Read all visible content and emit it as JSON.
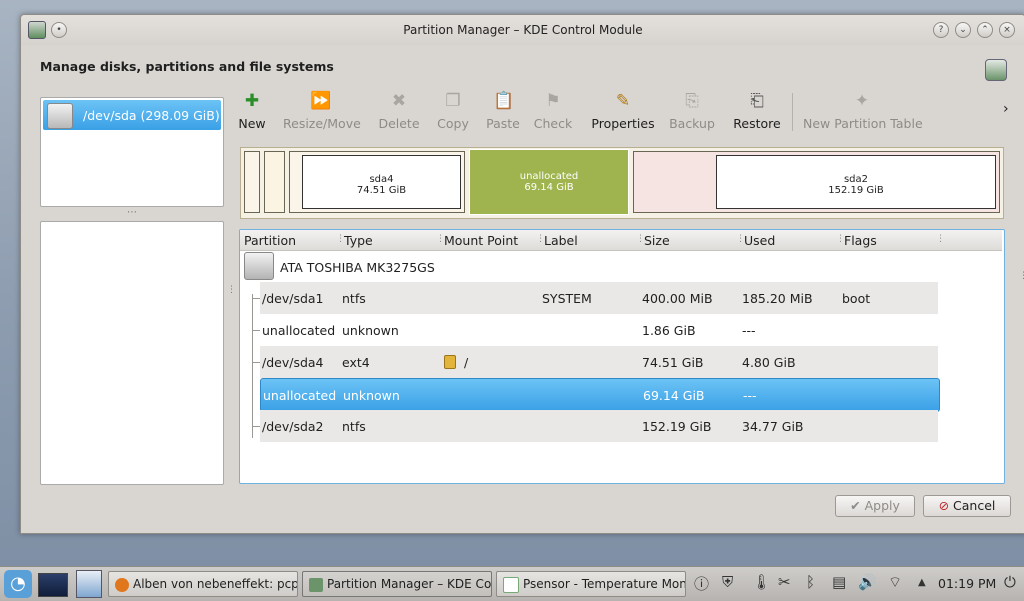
{
  "window": {
    "title": "Partition Manager – KDE Control Module"
  },
  "heading": "Manage disks, partitions and file systems",
  "devices": [
    {
      "label": "/dev/sda (298.09 GiB)"
    }
  ],
  "toolbar": {
    "items": [
      {
        "label": "New",
        "icon": "new-partition-icon",
        "enabled": true
      },
      {
        "label": "Resize/Move",
        "icon": "resize-icon",
        "enabled": false
      },
      {
        "label": "Delete",
        "icon": "delete-icon",
        "enabled": false
      },
      {
        "label": "Copy",
        "icon": "copy-icon",
        "enabled": false
      },
      {
        "label": "Paste",
        "icon": "paste-icon",
        "enabled": false
      },
      {
        "label": "Check",
        "icon": "check-icon",
        "enabled": false
      },
      {
        "label": "Properties",
        "icon": "properties-icon",
        "enabled": true
      },
      {
        "label": "Backup",
        "icon": "backup-icon",
        "enabled": false
      },
      {
        "label": "Restore",
        "icon": "restore-icon",
        "enabled": true
      },
      {
        "label": "New Partition Table",
        "icon": "partition-table-icon",
        "enabled": false
      }
    ],
    "more": "›"
  },
  "graph": {
    "sda4": {
      "name": "sda4",
      "size": "74.51 GiB"
    },
    "unalloc": {
      "name": "unallocated",
      "size": "69.14 GiB"
    },
    "sda2": {
      "name": "sda2",
      "size": "152.19 GiB"
    }
  },
  "table": {
    "columns": [
      "Partition",
      "Type",
      "Mount Point",
      "Label",
      "Size",
      "Used",
      "Flags"
    ],
    "drive": "ATA TOSHIBA MK3275GS",
    "rows": [
      {
        "partition": "/dev/sda1",
        "type": "ntfs",
        "mount": "",
        "label": "SYSTEM",
        "size": "400.00 MiB",
        "used": "185.20 MiB",
        "flags": "boot"
      },
      {
        "partition": "unallocated",
        "type": "unknown",
        "mount": "",
        "label": "",
        "size": "1.86 GiB",
        "used": "---",
        "flags": ""
      },
      {
        "partition": "/dev/sda4",
        "type": "ext4",
        "mount": "/",
        "label": "",
        "size": "74.51 GiB",
        "used": "4.80 GiB",
        "flags": ""
      },
      {
        "partition": "unallocated",
        "type": "unknown",
        "mount": "",
        "label": "",
        "size": "69.14 GiB",
        "used": "---",
        "flags": ""
      },
      {
        "partition": "/dev/sda2",
        "type": "ntfs",
        "mount": "",
        "label": "",
        "size": "152.19 GiB",
        "used": "34.77 GiB",
        "flags": ""
      }
    ],
    "selected_index": 3
  },
  "buttons": {
    "apply": "Apply",
    "cancel": "Cancel"
  },
  "taskbar": {
    "tasks": [
      {
        "label": "Alben von nebeneffekt: pcpr"
      },
      {
        "label": "Partition Manager – KDE Cont"
      },
      {
        "label": "Psensor - Temperature Monit"
      }
    ],
    "clock": "01:19 PM"
  },
  "colors": {
    "selection": "#3aa0e6",
    "unallocated": "#9fb44e"
  }
}
